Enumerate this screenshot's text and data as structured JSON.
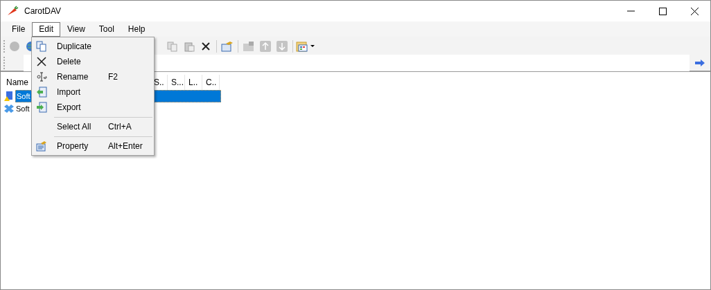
{
  "window": {
    "title": "CarotDAV"
  },
  "menu_bar": [
    {
      "label": "File",
      "selected": false
    },
    {
      "label": "Edit",
      "selected": true
    },
    {
      "label": "View",
      "selected": false
    },
    {
      "label": "Tool",
      "selected": false
    },
    {
      "label": "Help",
      "selected": false
    }
  ],
  "edit_menu": [
    {
      "kind": "item",
      "label": "Duplicate"
    },
    {
      "kind": "item",
      "label": "Delete"
    },
    {
      "kind": "item",
      "label": "Rename",
      "shortcut": "F2"
    },
    {
      "kind": "item",
      "label": "Import"
    },
    {
      "kind": "item",
      "label": "Export"
    },
    {
      "kind": "separator"
    },
    {
      "kind": "item",
      "label": "Select All",
      "shortcut": "Ctrl+A"
    },
    {
      "kind": "separator"
    },
    {
      "kind": "item",
      "label": "Property",
      "shortcut": "Alt+Enter"
    }
  ],
  "list": {
    "columns": [
      "Name",
      "S..",
      "S...",
      "L..",
      "C.."
    ],
    "rows": [
      {
        "name": "Soft",
        "selected": true
      },
      {
        "name": "Soft",
        "selected": false
      }
    ]
  }
}
